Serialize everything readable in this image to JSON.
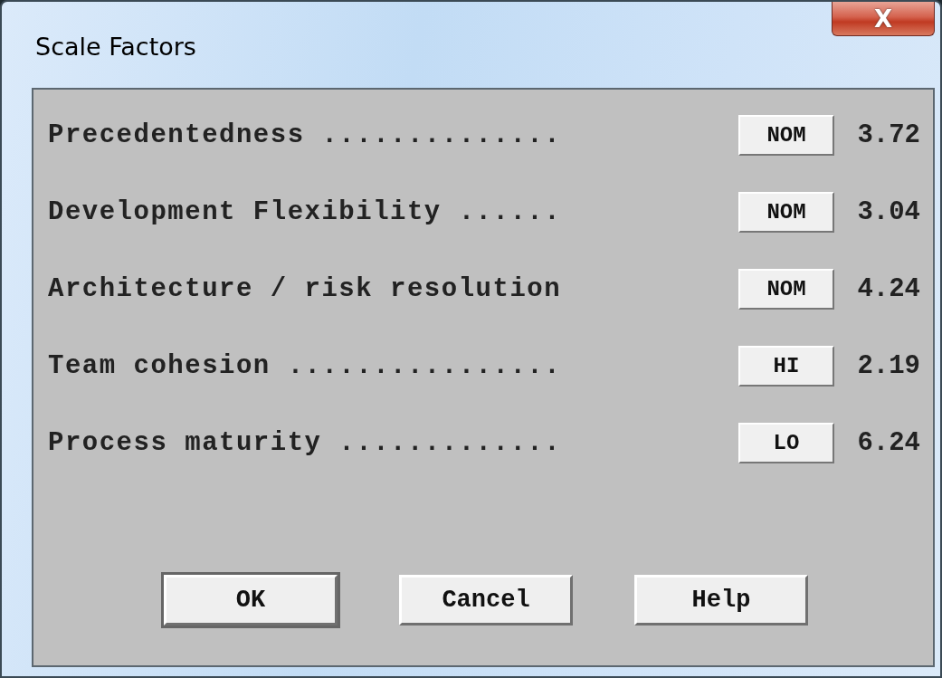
{
  "window": {
    "title": "Scale Factors",
    "close": "X"
  },
  "factors": [
    {
      "label": "Precedentedness ..............",
      "rating": "NOM",
      "value": "3.72"
    },
    {
      "label": "Development Flexibility ......",
      "rating": "NOM",
      "value": "3.04"
    },
    {
      "label": "Architecture / risk resolution",
      "rating": "NOM",
      "value": "4.24"
    },
    {
      "label": "Team cohesion ................",
      "rating": "HI",
      "value": "2.19"
    },
    {
      "label": "Process maturity .............",
      "rating": "LO",
      "value": "6.24"
    }
  ],
  "buttons": [
    {
      "label": "OK",
      "default": true
    },
    {
      "label": "Cancel",
      "default": false
    },
    {
      "label": "Help",
      "default": false
    }
  ]
}
